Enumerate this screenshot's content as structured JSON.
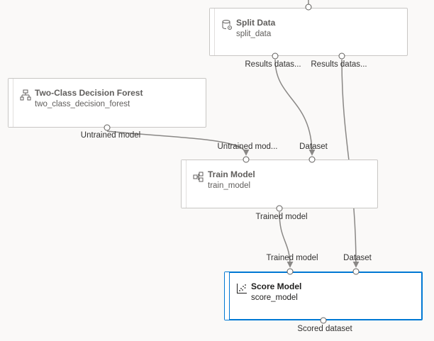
{
  "colors": {
    "canvas_bg": "#faf9f8",
    "node_border": "#c8c6c4",
    "selected_border": "#0078d4",
    "wire": "#8a8886",
    "text": "#323130"
  },
  "nodes": {
    "split_data": {
      "title": "Split Data",
      "subtitle": "split_data",
      "icon": "split-data-icon",
      "outputs": [
        "Results datas...",
        "Results datas..."
      ]
    },
    "decision_forest": {
      "title": "Two-Class Decision Forest",
      "subtitle": "two_class_decision_forest",
      "icon": "decision-tree-icon",
      "outputs": [
        "Untrained model"
      ]
    },
    "train_model": {
      "title": "Train Model",
      "subtitle": "train_model",
      "icon": "train-model-icon",
      "inputs": [
        "Untrained mod...",
        "Dataset"
      ],
      "outputs": [
        "Trained model"
      ]
    },
    "score_model": {
      "title": "Score Model",
      "subtitle": "score_model",
      "icon": "scatter-chart-icon",
      "selected": true,
      "inputs": [
        "Trained model",
        "Dataset"
      ],
      "outputs": [
        "Scored dataset"
      ]
    }
  }
}
